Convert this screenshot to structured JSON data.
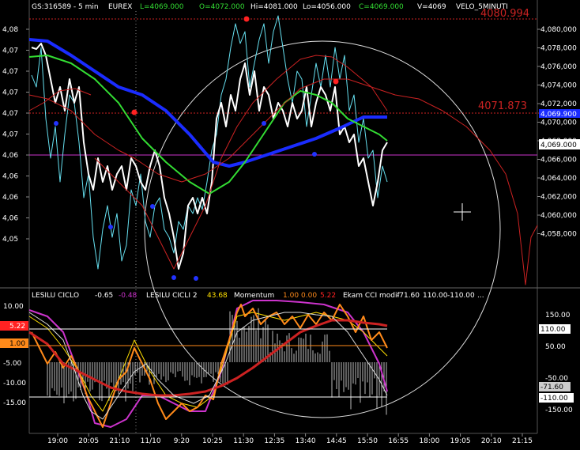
{
  "header": {
    "symbol": "GS:316589 - 5 min",
    "exchange": "EUREX",
    "last": "L=4069.000",
    "open": "O=4072.000",
    "high": "Hi=4081.000",
    "low": "Lo=4056.000",
    "close": "C=4069.000",
    "volume": "V=4069",
    "study": "VELO_5MINUTI"
  },
  "colors": {
    "background": "#000000",
    "price": "#ffffff",
    "cyan": "#66e0f0",
    "blue_ma": "#1a2cff",
    "green_ma": "#33dd33",
    "red_line": "#cc2222",
    "magenta": "#cc33cc",
    "orange": "#ff8a1a",
    "yellow": "#ffe000",
    "dots_blue": "#2233ff",
    "dots_red": "#ff2222"
  },
  "price_panel": {
    "left_ticks": [
      "4,08",
      "4,07",
      "4,07",
      "4,07",
      "4,07",
      "4,07",
      "4,06",
      "4,06",
      "4,06",
      "4,06",
      "4,05"
    ],
    "right_ticks": [
      "4,080,000",
      "4,078,000",
      "4,076,000",
      "4,074,000",
      "4,072,000",
      "4,070,000",
      "4,068,000",
      "4,066,000",
      "4,064,000",
      "4,062,000",
      "4,060,000",
      "4,058,000"
    ],
    "price_tag": "4,069.000",
    "blue_tag": "4,069.900",
    "level_top": "4080.994",
    "level_mid": "4071.873"
  },
  "indicator_panel": {
    "legend": [
      {
        "text": "LESILU CICLO",
        "color": "#ffffff"
      },
      {
        "text": "-0.65",
        "color": "#ffffff"
      },
      {
        "text": "-0.48",
        "color": "#cc33cc"
      },
      {
        "text": "LESILU CICLI 2",
        "color": "#ffffff"
      },
      {
        "text": "43.68",
        "color": "#ffe000"
      },
      {
        "text": "Momentum",
        "color": "#ffffff"
      },
      {
        "text": "1.00",
        "color": "#ff8a1a"
      },
      {
        "text": "0.00",
        "color": "#ff8a1a"
      },
      {
        "text": "5.22",
        "color": "#ff2222"
      },
      {
        "text": "Ekam CCI modif",
        "color": "#ffffff"
      },
      {
        "text": "-71.60",
        "color": "#ffffff"
      },
      {
        "text": "110.00",
        "color": "#ffffff"
      },
      {
        "text": "-110.00",
        "color": "#ffffff"
      },
      {
        "text": "...",
        "color": "#ffffff"
      }
    ],
    "left_ticks": [
      "10.00",
      "5.00",
      "0.00",
      "-5.00",
      "-10.00",
      "-15.00"
    ],
    "left_tag_red": "5.22",
    "left_tag_orange": "1.00",
    "right_ticks": [
      "150.00",
      "100.00",
      "50.00",
      "-50.00",
      "-100.00",
      "-150.00"
    ],
    "right_tag_110": "110.00",
    "right_tag_m71": "-71.60",
    "right_tag_m110": "-110.00"
  },
  "time_axis": [
    "19:00",
    "20:05",
    "21:10",
    "11/10",
    "9:20",
    "10:25",
    "11:30",
    "12:35",
    "13:40",
    "14:45",
    "15:50",
    "16:55",
    "18:00",
    "19:05",
    "20:10",
    "21:15"
  ]
}
